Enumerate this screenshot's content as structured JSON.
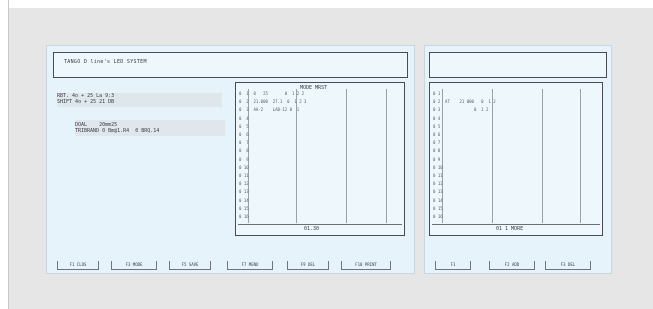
{
  "main_panel": {
    "title": "TANGO D line's LED SYSTEM",
    "kv_lines": [
      "RBT. 4o + 25 La 9:3",
      "SHIFT 4o + 25 21 DB"
    ],
    "detail_lines": [
      "DOAL    20mm25",
      "TRIBRAND 0 Bm@1.R4  0 BRQ.14"
    ],
    "grid_header": "MODE MRST",
    "grid_rows": [
      "0  1  0   25       0  1 2 2",
      "0  2  21.000  27.1  0  1 2 3",
      "0  3  AA-2    LAB-12 0  1",
      "0  4",
      "0  5",
      "0  6",
      "0  7",
      "0  8",
      "0  9",
      "0 10",
      "0 11",
      "0 12",
      "0 13",
      "0 14",
      "0 15",
      "0 16"
    ],
    "grid_footer": "01.30",
    "buttons": [
      "F1 CLOS",
      "F3 MODE",
      "F5 SAVE",
      "F7 MENU",
      "F9 DEL",
      "F10 PRINT"
    ]
  },
  "side_panel": {
    "title": "",
    "grid_rows": [
      "0 1",
      "0 2  AT    21 000   0  1 2",
      "0 3              0  1 2",
      "0 4",
      "0 5",
      "0 6",
      "0 7",
      "0 8",
      "0 9",
      "0 10",
      "0 11",
      "0 12",
      "0 13",
      "0 14",
      "0 15",
      "0 16"
    ],
    "grid_footer": "01 1 MORE",
    "buttons": [
      "F1",
      "F2 ADD",
      "F3 DEL"
    ]
  }
}
